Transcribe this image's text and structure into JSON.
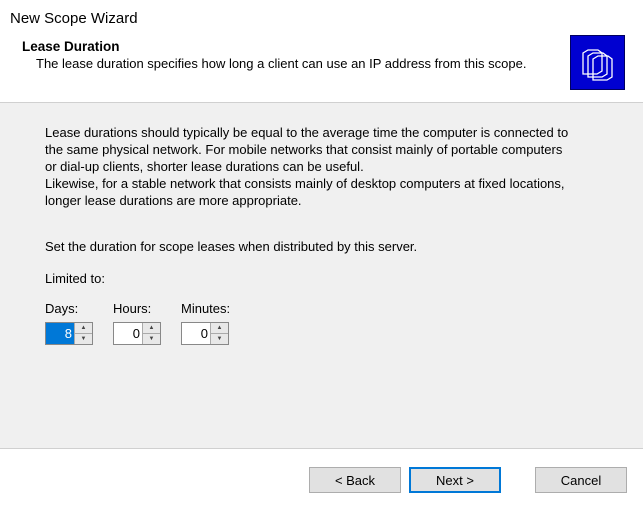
{
  "window": {
    "title": "New Scope Wizard"
  },
  "header": {
    "page_title": "Lease Duration",
    "subtitle": "The lease duration specifies how long a client can use an IP address from this scope.",
    "icon_name": "folders-icon"
  },
  "content": {
    "paragraph1": "Lease durations should typically be equal to the average time the computer is connected to the same physical network. For mobile networks that consist mainly of portable computers or dial-up clients, shorter lease durations can be useful.",
    "paragraph2": "Likewise, for a stable network that consists mainly of desktop computers at fixed locations, longer lease durations are more appropriate.",
    "set_duration_text": "Set the duration for scope leases when distributed by this server.",
    "limited_to_label": "Limited to:",
    "spinners": {
      "days": {
        "label": "Days:",
        "value": "8"
      },
      "hours": {
        "label": "Hours:",
        "value": "0"
      },
      "minutes": {
        "label": "Minutes:",
        "value": "0"
      }
    }
  },
  "buttons": {
    "back": "< Back",
    "next": "Next >",
    "cancel": "Cancel"
  }
}
